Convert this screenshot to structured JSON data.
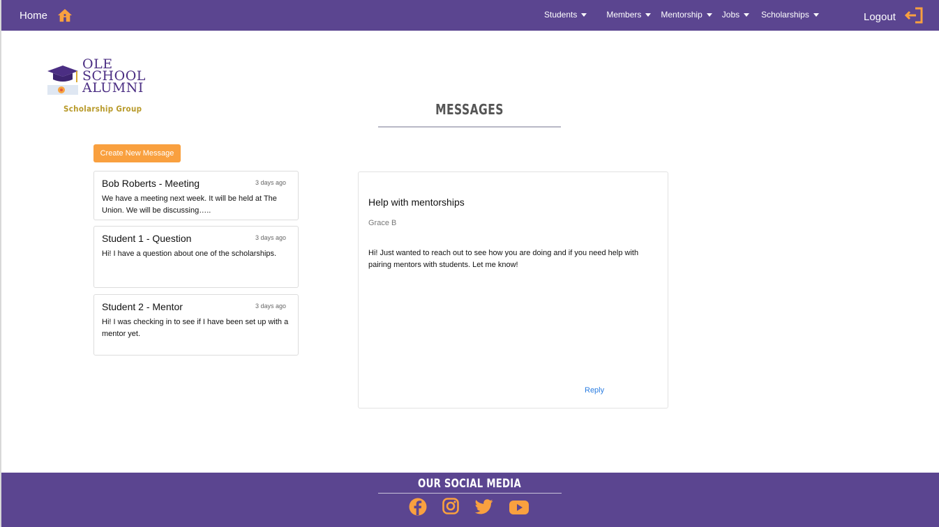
{
  "nav": {
    "home_label": "Home",
    "home_icon": "home-icon",
    "menu": [
      {
        "label": "Students"
      },
      {
        "label": "Members"
      },
      {
        "label": "Mentorship"
      },
      {
        "label": "Jobs"
      },
      {
        "label": "Scholarships"
      }
    ],
    "logout_label": "Logout",
    "logout_icon": "logout-icon"
  },
  "logo": {
    "line1": "OLE",
    "line2": "SCHOOL",
    "line3": "ALUMNI",
    "subtitle": "Scholarship Group"
  },
  "page": {
    "title": "MESSAGES",
    "create_button": "Create New Message"
  },
  "messages": [
    {
      "title": "Bob Roberts - Meeting",
      "time": "3 days ago",
      "preview": "We have a meeting next week. It will be held at The Union. We will be discussing….."
    },
    {
      "title": "Student 1 - Question",
      "time": "3 days ago",
      "preview": "Hi! I have a question about one of the scholarships."
    },
    {
      "title": "Student 2 - Mentor",
      "time": "3 days ago",
      "preview": "Hi! I was checking in to see if I have been set up with a mentor yet."
    }
  ],
  "detail": {
    "subject": "Help with mentorships",
    "sender": "Grace B",
    "body": "Hi! Just wanted to reach out to see how you are doing and if you need help with pairing mentors with students. Let me know!",
    "reply": "Reply"
  },
  "footer": {
    "title": "OUR SOCIAL MEDIA",
    "icons": [
      "facebook-icon",
      "instagram-icon",
      "twitter-icon",
      "youtube-icon"
    ]
  },
  "colors": {
    "brand_purple": "#5b4590",
    "accent_orange": "#f9a03f",
    "link_blue": "#2a7de1",
    "logo_gold": "#b89a2a"
  }
}
